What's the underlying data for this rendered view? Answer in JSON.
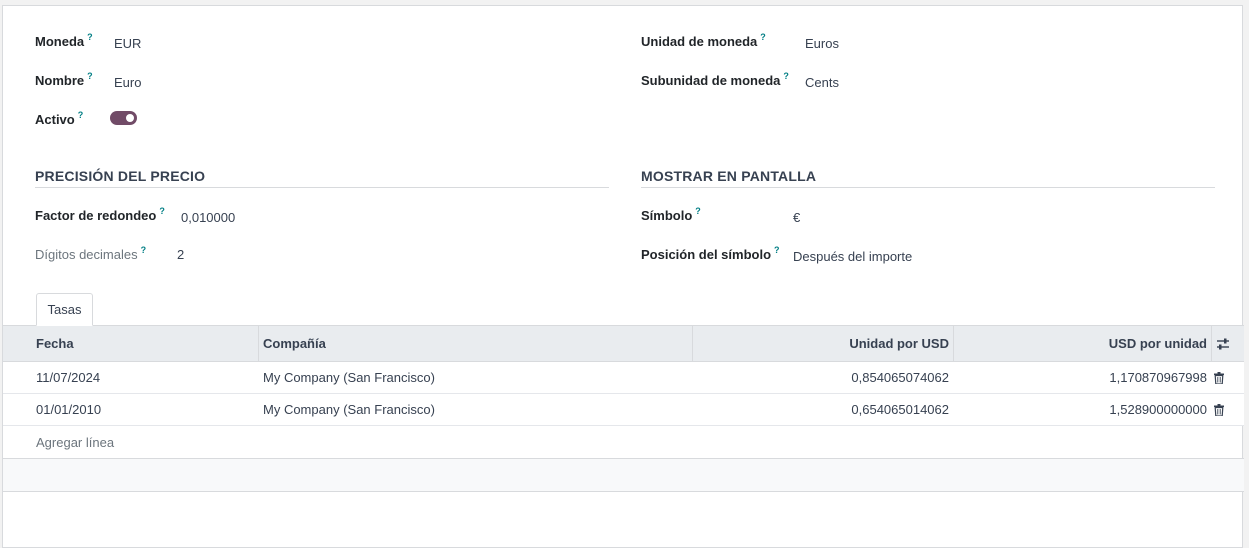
{
  "form": {
    "left": [
      {
        "label": "Moneda",
        "value": "EUR"
      },
      {
        "label": "Nombre",
        "value": "Euro"
      },
      {
        "label": "Activo",
        "value": ""
      }
    ],
    "right": [
      {
        "label": "Unidad de moneda",
        "value": "Euros"
      },
      {
        "label": "Subunidad de moneda",
        "value": "Cents"
      }
    ],
    "help_mark": "?",
    "active": true
  },
  "sections": {
    "price_precision": {
      "title": "PRECISIÓN DEL PRECIO",
      "fields": [
        {
          "label": "Factor de redondeo",
          "value": "0,010000"
        },
        {
          "label": "Dígitos decimales",
          "value": "2"
        }
      ]
    },
    "display": {
      "title": "MOSTRAR EN PANTALLA",
      "fields": [
        {
          "label": "Símbolo",
          "value": "€"
        },
        {
          "label": "Posición del símbolo",
          "value": "Después del importe"
        }
      ]
    }
  },
  "tabs": [
    {
      "label": "Tasas",
      "active": true
    }
  ],
  "table": {
    "columns": [
      "Fecha",
      "Compañía",
      "Unidad por USD",
      "USD por unidad"
    ],
    "rows": [
      {
        "date": "11/07/2024",
        "company": "My Company (San Francisco)",
        "unit_per_usd": "0,854065074062",
        "usd_per_unit": "1,170870967998"
      },
      {
        "date": "01/01/2010",
        "company": "My Company (San Francisco)",
        "unit_per_usd": "0,654065014062",
        "usd_per_unit": "1,528900000000"
      }
    ],
    "add_line": "Agregar línea",
    "optional_columns_icon": "sliders-icon",
    "row_delete_icon": "trash-icon"
  },
  "colors": {
    "toggle_on": "#714b67",
    "help": "#017e84",
    "header_bg": "#e9ecef"
  }
}
